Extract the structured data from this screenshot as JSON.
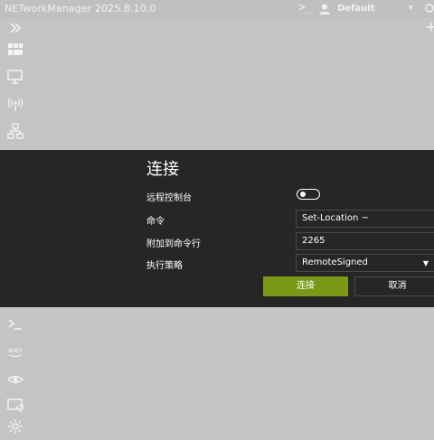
{
  "window": {
    "title": "NETworkManager 2025.8.10.0",
    "profile": "Default"
  },
  "sidebar": {
    "items": [
      {
        "icon": "expand-icon"
      },
      {
        "icon": "dashboard-icon"
      },
      {
        "icon": "network-interface-icon"
      },
      {
        "icon": "wifi-icon"
      },
      {
        "icon": "network-icon"
      },
      {
        "icon": "terminal-icon"
      },
      {
        "icon": "aws-icon"
      },
      {
        "icon": "eye-icon"
      },
      {
        "icon": "screen-cast-icon"
      },
      {
        "icon": "settings-icon"
      }
    ]
  },
  "dialog": {
    "title": "连接",
    "remote_console_label": "远程控制台",
    "command_label": "命令",
    "command_value": "Set-Location ~",
    "append_label": "附加到命令行",
    "append_value": "2265",
    "policy_label": "执行策略",
    "policy_value": "RemoteSigned",
    "connect_button": "连接",
    "cancel_button": "取消"
  },
  "colors": {
    "accent": "#7a9a16",
    "dialog_bg": "#262626",
    "app_bg": "#c4c4c4"
  }
}
